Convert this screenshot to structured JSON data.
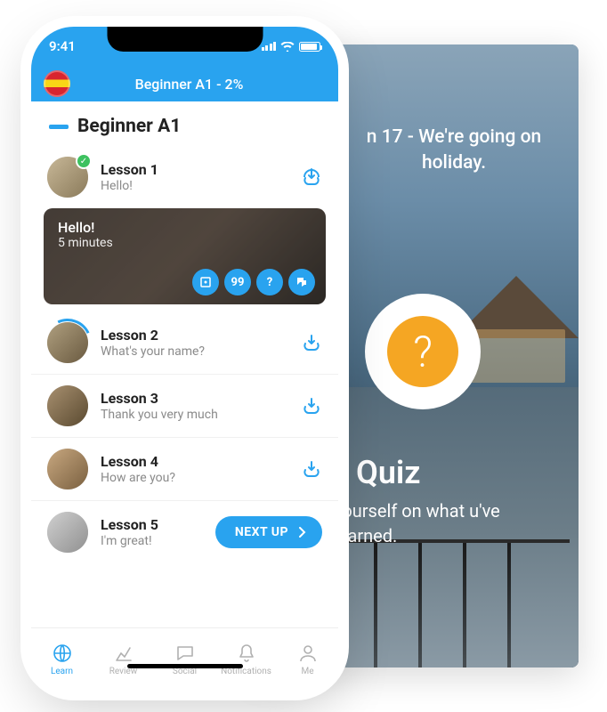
{
  "statusbar": {
    "time": "9:41"
  },
  "header": {
    "title": "Beginner A1 - 2%"
  },
  "section": {
    "title": "Beginner A1"
  },
  "lessons": [
    {
      "title": "Lesson 1",
      "sub": "Hello!"
    },
    {
      "title": "Lesson 2",
      "sub": "What's your name?"
    },
    {
      "title": "Lesson 3",
      "sub": "Thank you very much"
    },
    {
      "title": "Lesson 4",
      "sub": "How are you?"
    },
    {
      "title": "Lesson 5",
      "sub": "I'm great!"
    }
  ],
  "expanded": {
    "title": "Hello!",
    "sub": "5 minutes",
    "badge": "99"
  },
  "next_button": "NEXT UP",
  "tabs": [
    {
      "label": "Learn"
    },
    {
      "label": "Review"
    },
    {
      "label": "Social"
    },
    {
      "label": "Notifications"
    },
    {
      "label": "Me"
    }
  ],
  "bg": {
    "lesson_line": "n 17 - We're going on holiday.",
    "quiz_title": "Quiz",
    "quiz_sub": "yourself on what u've learned."
  }
}
